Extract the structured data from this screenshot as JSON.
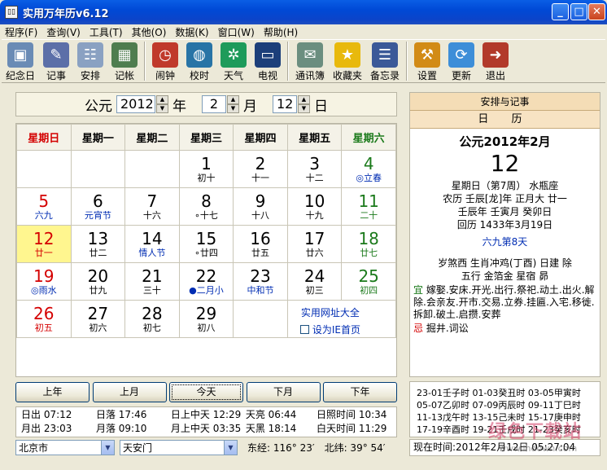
{
  "window": {
    "title": "实用万年历v6.12",
    "app_icon_text": "▯▯"
  },
  "menu": [
    "程序(F)",
    "查询(V)",
    "工具(T)",
    "其他(O)",
    "数据(K)",
    "窗口(W)",
    "帮助(H)"
  ],
  "toolbar": [
    {
      "label": "纪念日",
      "icon": "film-icon",
      "color": "#6a8bb5",
      "glyph": "▣"
    },
    {
      "label": "记事",
      "icon": "notepad-icon",
      "color": "#5c6fa8",
      "glyph": "✎"
    },
    {
      "label": "安排",
      "icon": "schedule-icon",
      "color": "#8aa1c2",
      "glyph": "☷"
    },
    {
      "label": "记帐",
      "icon": "calculator-icon",
      "color": "#4f7d4f",
      "glyph": "▦"
    },
    {
      "label": "闹钟",
      "icon": "alarm-clock-icon",
      "color": "#c0392b",
      "glyph": "◷"
    },
    {
      "label": "校时",
      "icon": "globe-clock-icon",
      "color": "#2874a6",
      "glyph": "◍"
    },
    {
      "label": "天气",
      "icon": "weather-icon",
      "color": "#1e9b5a",
      "glyph": "✲"
    },
    {
      "label": "电视",
      "icon": "tv-icon",
      "color": "#1c3f7a",
      "glyph": "▭"
    },
    {
      "label": "通讯簿",
      "icon": "address-book-icon",
      "color": "#6b8e7f",
      "glyph": "✉"
    },
    {
      "label": "收藏夹",
      "icon": "star-icon",
      "color": "#e8b90c",
      "glyph": "★"
    },
    {
      "label": "备忘录",
      "icon": "memo-icon",
      "color": "#3b5998",
      "glyph": "☰"
    },
    {
      "label": "设置",
      "icon": "settings-tools-icon",
      "color": "#d28b16",
      "glyph": "⚒"
    },
    {
      "label": "更新",
      "icon": "update-icon",
      "color": "#3d8ed8",
      "glyph": "⟳"
    },
    {
      "label": "退出",
      "icon": "exit-door-icon",
      "color": "#b23a2a",
      "glyph": "➜"
    }
  ],
  "date_selector": {
    "era": "公元",
    "year": "2012",
    "year_unit": "年",
    "month": "2",
    "month_unit": "月",
    "day": "12",
    "day_unit": "日"
  },
  "weekdays": [
    "星期日",
    "星期一",
    "星期二",
    "星期三",
    "星期四",
    "星期五",
    "星期六"
  ],
  "calendar_weeks": [
    [
      null,
      null,
      null,
      {
        "d": "1",
        "l": "初十",
        "lc": ""
      },
      {
        "d": "2",
        "l": "十一",
        "lc": ""
      },
      {
        "d": "3",
        "l": "十二",
        "lc": ""
      },
      {
        "d": "4",
        "l": "◎立春",
        "lc": "blue"
      }
    ],
    [
      {
        "d": "5",
        "l": "六九",
        "lc": "blue"
      },
      {
        "d": "6",
        "l": "元宵节",
        "lc": "blue"
      },
      {
        "d": "7",
        "l": "十六",
        "lc": ""
      },
      {
        "d": "8",
        "l": "∘十七",
        "lc": ""
      },
      {
        "d": "9",
        "l": "十八",
        "lc": ""
      },
      {
        "d": "10",
        "l": "十九",
        "lc": ""
      },
      {
        "d": "11",
        "l": "二十",
        "lc": "green"
      }
    ],
    [
      {
        "d": "12",
        "l": "廿一",
        "lc": "red",
        "today": true
      },
      {
        "d": "13",
        "l": "廿二",
        "lc": ""
      },
      {
        "d": "14",
        "l": "情人节",
        "lc": "blue"
      },
      {
        "d": "15",
        "l": "∘廿四",
        "lc": ""
      },
      {
        "d": "16",
        "l": "廿五",
        "lc": ""
      },
      {
        "d": "17",
        "l": "廿六",
        "lc": ""
      },
      {
        "d": "18",
        "l": "廿七",
        "lc": "green"
      }
    ],
    [
      {
        "d": "19",
        "l": "◎雨水",
        "lc": "blue"
      },
      {
        "d": "20",
        "l": "廿九",
        "lc": ""
      },
      {
        "d": "21",
        "l": "三十",
        "lc": ""
      },
      {
        "d": "22",
        "l": "●二月小",
        "lc": "blue"
      },
      {
        "d": "23",
        "l": "中和节",
        "lc": "blue"
      },
      {
        "d": "24",
        "l": "初三",
        "lc": ""
      },
      {
        "d": "25",
        "l": "初四",
        "lc": "green"
      }
    ],
    [
      {
        "d": "26",
        "l": "初五",
        "lc": "red"
      },
      {
        "d": "27",
        "l": "初六",
        "lc": ""
      },
      {
        "d": "28",
        "l": "初七",
        "lc": ""
      },
      {
        "d": "29",
        "l": "初八",
        "lc": ""
      },
      null,
      null,
      null
    ]
  ],
  "links": {
    "web_directory": "实用网址大全",
    "set_homepage": "设为IE首页"
  },
  "nav_buttons": [
    "上年",
    "上月",
    "今天",
    "下月",
    "下年"
  ],
  "sun_moon": {
    "row1": [
      "日出 07:12",
      "日落 17:46",
      "日上中天 12:29",
      "天亮 06:44",
      "日照时间 10:34"
    ],
    "row2": [
      "月出 23:03",
      "月落 09:10",
      "月上中天 03:35",
      "天黑 18:14",
      "白天时间 11:29"
    ]
  },
  "location": {
    "city": "北京市",
    "place": "天安门",
    "longitude": "东经: 116° 23′",
    "latitude": "北纬: 39° 54′"
  },
  "right_panel": {
    "header": "安排与记事",
    "subheader": "日 历",
    "year_month": "公元2012年2月",
    "day": "12",
    "week_line": "星期日（第7周） 水瓶座",
    "lunar_line": "农历 壬辰[龙]年 正月大 廿一",
    "ganzhi_line": "壬辰年 壬寅月 癸卯日",
    "hijri_line": "回历 1433年3月19日",
    "nine_line": "六九第8天",
    "sha_line": "岁煞西 生肖冲鸡(丁酉)  日建 除",
    "wuxing_line": "五行 金箔金    星宿 昴",
    "yi_label": "宜",
    "yi_text": "嫁娶.安床.开光.出行.祭祀.动土.出火.解除.会亲友.开市.交易.立券.挂匾.入宅.移徙.拆卸.破土.启攒.安葬",
    "ji_label": "忌",
    "ji_text": "掘井.词讼"
  },
  "solar_terms": [
    "23-01壬子时 01-03癸丑时 03-05甲寅时",
    "05-07乙卯时 07-09丙辰时 09-11丁巳时",
    "11-13戊午时 13-15己未时 15-17庚申时",
    "17-19辛酉时 19-21壬戌时 21-23癸亥时"
  ],
  "now_time": "现在时间:2012年2月12日 05:27:04",
  "watermark": {
    "main": "绿色下载站",
    "sub": "www.lhdown.com"
  }
}
